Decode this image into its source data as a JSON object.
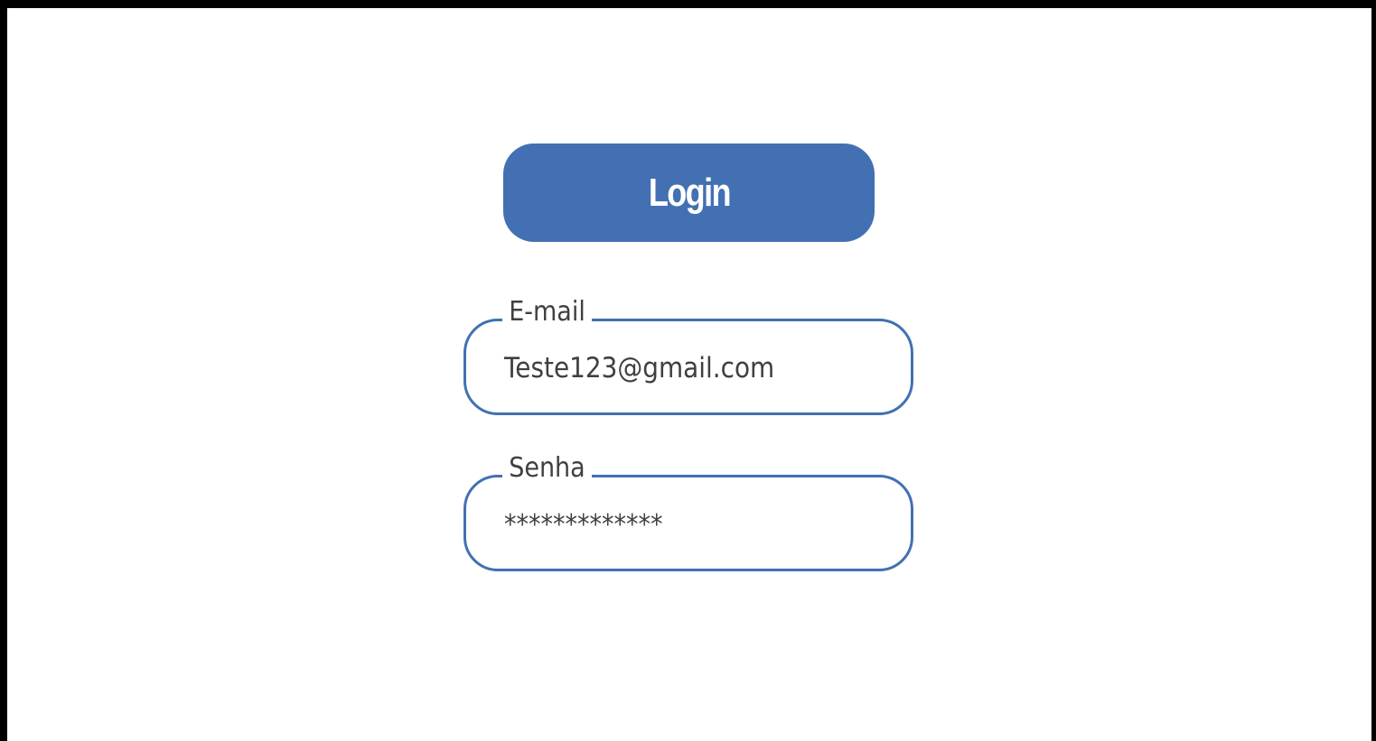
{
  "login": {
    "button_label": "Login"
  },
  "form": {
    "email": {
      "label": "E-mail",
      "value": "Teste123@gmail.com"
    },
    "password": {
      "label": "Senha",
      "value": "*************"
    }
  },
  "colors": {
    "accent": "#4270b3",
    "background": "#ffffff",
    "frame": "#000000",
    "text": "#404040"
  }
}
